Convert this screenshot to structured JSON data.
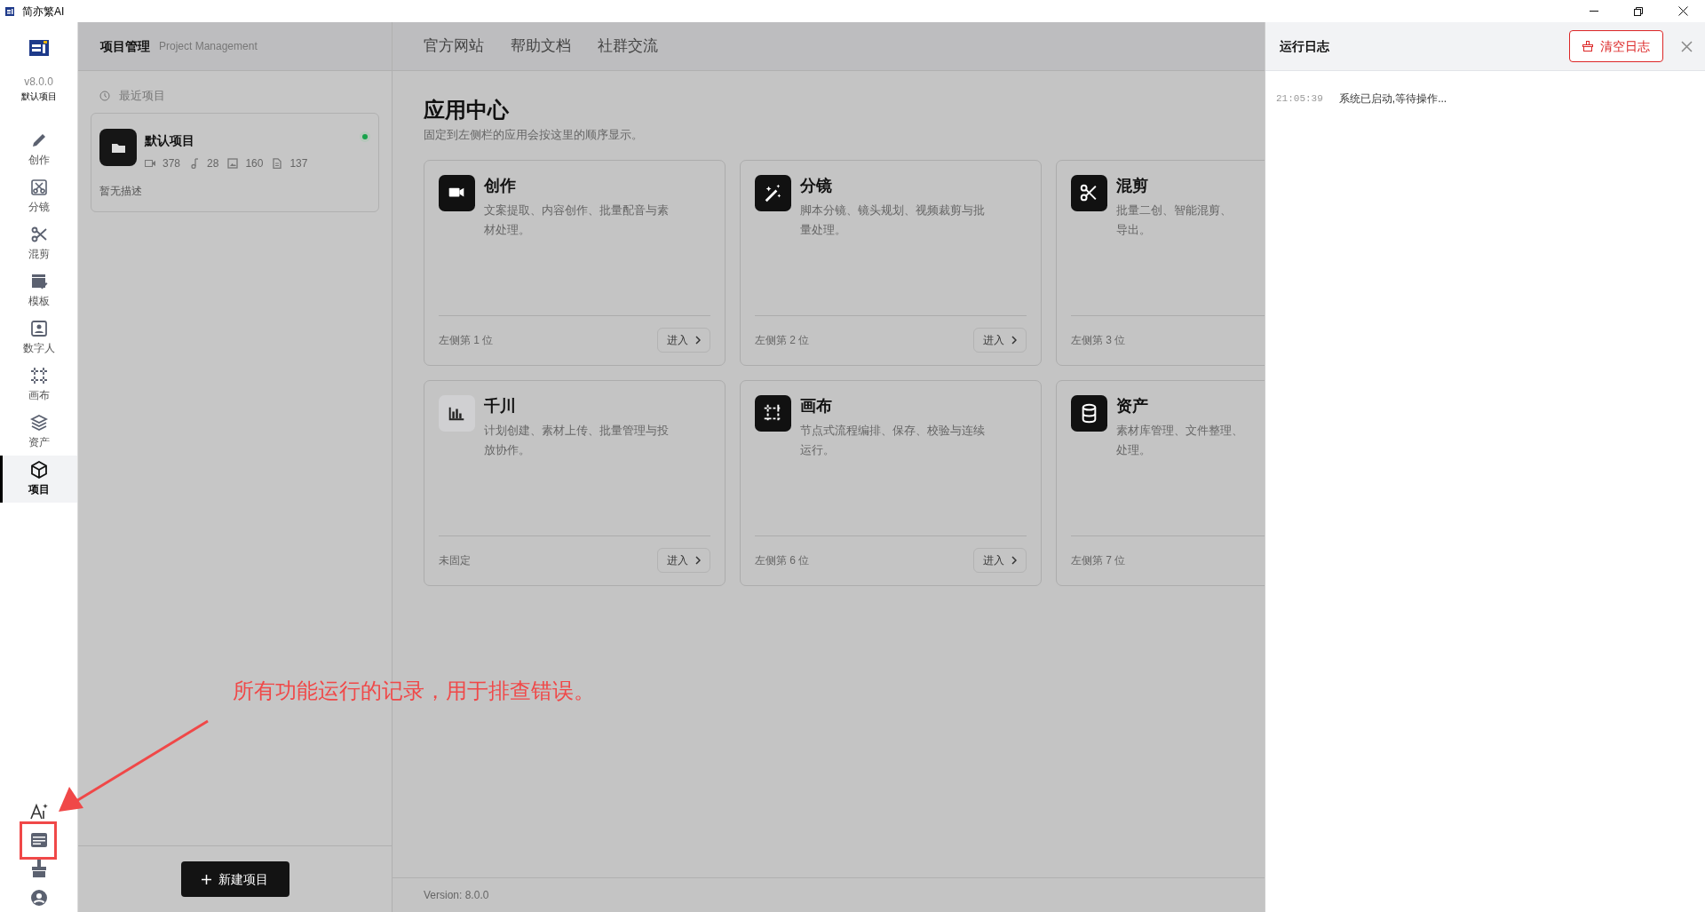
{
  "window": {
    "title": "简亦繁AI"
  },
  "sidebar": {
    "version": "v8.0.0",
    "project": "默认项目",
    "items": [
      {
        "label": "创作",
        "selected": false
      },
      {
        "label": "分镜",
        "selected": false
      },
      {
        "label": "混剪",
        "selected": false
      },
      {
        "label": "模板",
        "selected": false
      },
      {
        "label": "数字人",
        "selected": false
      },
      {
        "label": "画布",
        "selected": false
      },
      {
        "label": "资产",
        "selected": false
      },
      {
        "label": "项目",
        "selected": true
      }
    ]
  },
  "project_panel": {
    "title": "项目管理",
    "subtitle": "Project Management",
    "recent_label": "最近项目",
    "projects": [
      {
        "name": "默认项目",
        "active": true,
        "stats": [
          {
            "kind": "video",
            "value": "378"
          },
          {
            "kind": "music",
            "value": "28"
          },
          {
            "kind": "image",
            "value": "160"
          },
          {
            "kind": "doc",
            "value": "137"
          }
        ],
        "description": "暂无描述"
      }
    ],
    "new_button": "新建项目"
  },
  "top_links": [
    "官方网站",
    "帮助文档",
    "社群交流"
  ],
  "app_center": {
    "title": "应用中心",
    "subtitle": "固定到左侧栏的应用会按这里的顺序显示。",
    "cards": [
      {
        "title": "创作",
        "pinned": true,
        "lines": [
          "文案提取、内容创作、批量配音与素",
          "材处理。"
        ],
        "position": "左侧第 1 位",
        "button": "进入"
      },
      {
        "title": "分镜",
        "pinned": true,
        "lines": [
          "脚本分镜、镜头规划、视频裁剪与批",
          "量处理。"
        ],
        "position": "左侧第 2 位",
        "button": "进入"
      },
      {
        "title": "混剪",
        "pinned": true,
        "lines": [
          "批量二创、智能混剪、",
          "导出。"
        ],
        "position": "左侧第 3 位"
      },
      {
        "title": "千川",
        "pinned": false,
        "lines": [
          "计划创建、素材上传、批量管理与投",
          "放协作。"
        ],
        "position": "未固定",
        "button": "进入"
      },
      {
        "title": "画布",
        "pinned": true,
        "lines": [
          "节点式流程编排、保存、校验与连续",
          "运行。"
        ],
        "position": "左侧第 6 位",
        "button": "进入"
      },
      {
        "title": "资产",
        "pinned": true,
        "lines": [
          "素材库管理、文件整理、",
          "处理。"
        ],
        "position": "左侧第 7 位"
      }
    ]
  },
  "footer": {
    "version": "Version: 8.0.0"
  },
  "log_panel": {
    "title": "运行日志",
    "clear_button": "清空日志",
    "entries": [
      {
        "time": "21:05:39",
        "message": "系统已启动,等待操作..."
      }
    ]
  },
  "annotation": {
    "text": "所有功能运行的记录，用于排查错误。"
  }
}
